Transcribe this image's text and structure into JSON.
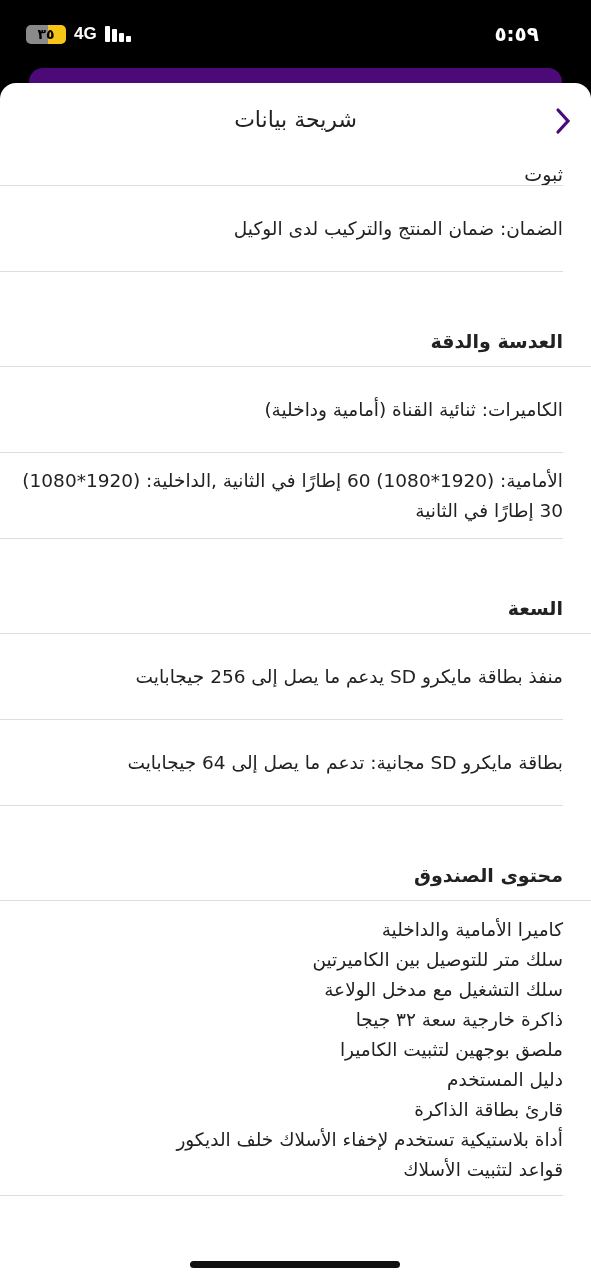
{
  "status_bar": {
    "time": "٥:٥٩",
    "network": "4G",
    "battery": "٣٥"
  },
  "header": {
    "title": "شريحة بيانات"
  },
  "items": [
    {
      "kind": "cut",
      "text": "ثبوت"
    },
    {
      "kind": "row",
      "text": "الضمان: ضمان المنتج والتركيب لدى الوكيل"
    },
    {
      "kind": "heading",
      "text": "العدسة والدقة"
    },
    {
      "kind": "row",
      "text": "الكاميرات: ثنائية القناة (أمامية وداخلية)"
    },
    {
      "kind": "row",
      "text": "الأمامية: (1920*1080) 60 إطارًا في الثانية ,الداخلية: (1920*1080) 30 إطارًا في الثانية"
    },
    {
      "kind": "heading",
      "text": "السعة"
    },
    {
      "kind": "row",
      "text": "منفذ بطاقة مايكرو SD يدعم ما يصل إلى 256 جيجابايت"
    },
    {
      "kind": "row",
      "text": "بطاقة مايكرو SD مجانية: تدعم ما يصل إلى 64 جيجابايت"
    },
    {
      "kind": "heading",
      "text": "محتوى الصندوق"
    },
    {
      "kind": "list",
      "lines": [
        "كاميرا الأمامية والداخلية",
        "سلك متر للتوصيل بين الكاميرتين",
        "سلك التشغيل مع مدخل الولاعة",
        "ذاكرة خارجية سعة ٣٢ جيجا",
        "ملصق بوجهين لتثبيت الكاميرا",
        "دليل المستخدم",
        "قارئ بطاقة الذاكرة",
        "أداة بلاستيكية تستخدم لإخفاء الأسلاك خلف الديكور",
        "قواعد لتثبيت الأسلاك"
      ]
    }
  ]
}
